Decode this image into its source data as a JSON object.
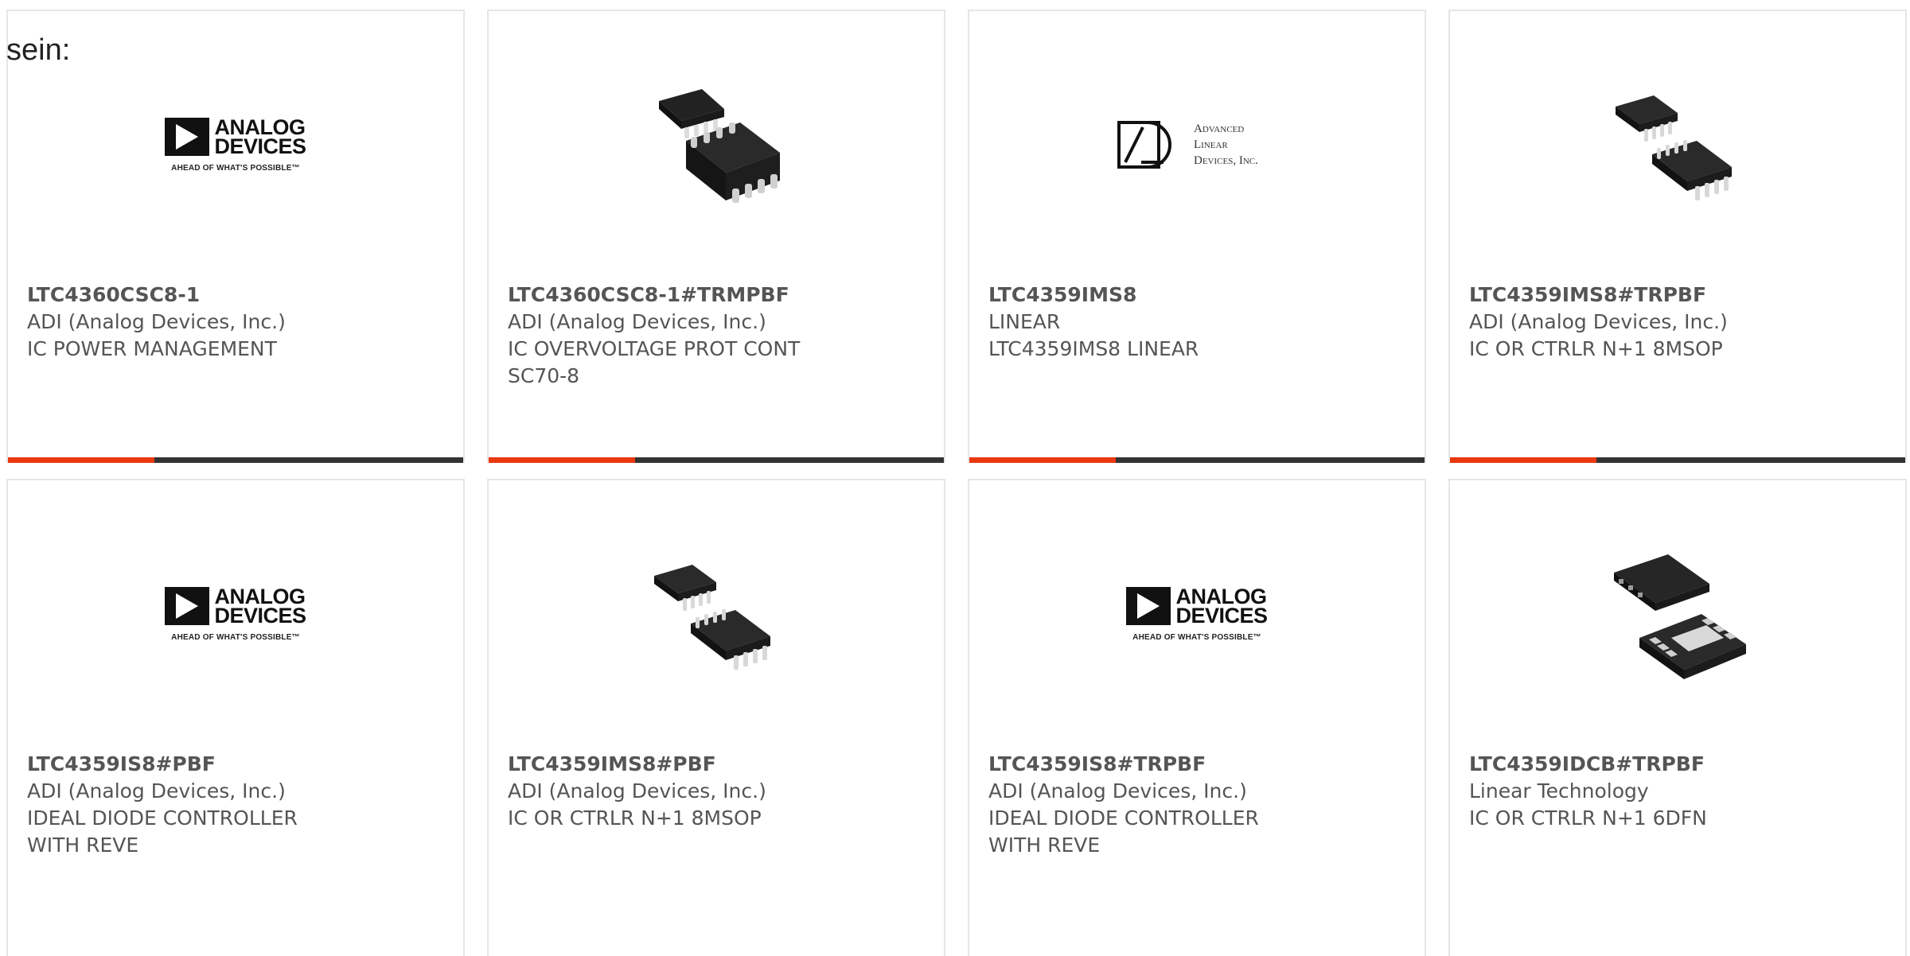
{
  "intro": "sein:",
  "colors": {
    "accent": "#e8380d",
    "bar": "#333333",
    "border": "#e6e6e6",
    "text": "#555555"
  },
  "logos": {
    "adi": {
      "line1": "ANALOG",
      "line2": "DEVICES",
      "tagline": "AHEAD OF WHAT'S POSSIBLE™"
    },
    "ald": {
      "line1": "Advanced",
      "line2": "Linear",
      "line3": "Devices, Inc."
    }
  },
  "cards": [
    {
      "part_number": "LTC4360CSC8-1",
      "manufacturer": "ADI (Analog Devices, Inc.)",
      "description": "IC POWER MANAGEMENT",
      "image": "adi-logo"
    },
    {
      "part_number": "LTC4360CSC8-1#TRMPBF",
      "manufacturer": "ADI (Analog Devices, Inc.)",
      "description": "IC OVERVOLTAGE PROT CONT\nSC70-8",
      "image": "soic8-chip-icon"
    },
    {
      "part_number": "LTC4359IMS8",
      "manufacturer": "LINEAR",
      "description": "LTC4359IMS8 LINEAR",
      "image": "ald-logo"
    },
    {
      "part_number": "LTC4359IMS8#TRPBF",
      "manufacturer": "ADI (Analog Devices, Inc.)",
      "description": "IC OR CTRLR N+1 8MSOP",
      "image": "msop8-chip-icon"
    },
    {
      "part_number": "LTC4359IS8#PBF",
      "manufacturer": "ADI (Analog Devices, Inc.)",
      "description": "IDEAL DIODE CONTROLLER\nWITH REVE",
      "image": "adi-logo"
    },
    {
      "part_number": "LTC4359IMS8#PBF",
      "manufacturer": "ADI (Analog Devices, Inc.)",
      "description": "IC OR CTRLR N+1 8MSOP",
      "image": "msop8-chip-icon"
    },
    {
      "part_number": "LTC4359IS8#TRPBF",
      "manufacturer": "ADI (Analog Devices, Inc.)",
      "description": "IDEAL DIODE CONTROLLER\nWITH REVE",
      "image": "adi-logo"
    },
    {
      "part_number": "LTC4359IDCB#TRPBF",
      "manufacturer": "Linear Technology",
      "description": "IC OR CTRLR N+1 6DFN",
      "image": "dfn6-chip-icon"
    }
  ]
}
